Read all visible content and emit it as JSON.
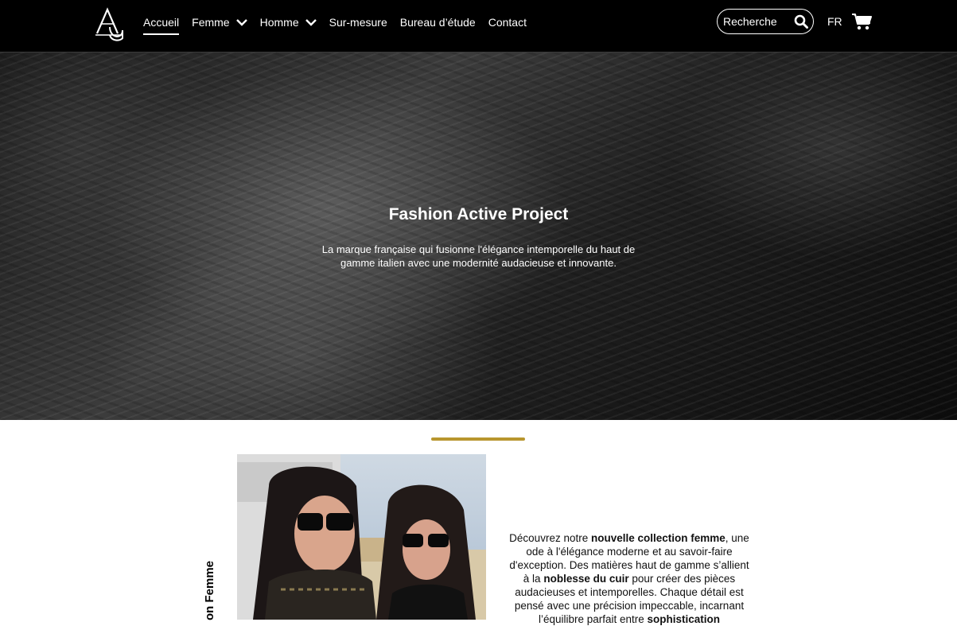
{
  "nav": {
    "logo_alt": "AG",
    "items": [
      {
        "label": "Accueil",
        "active": true,
        "dropdown": false
      },
      {
        "label": "Femme",
        "active": false,
        "dropdown": true
      },
      {
        "label": "Homme",
        "active": false,
        "dropdown": true
      },
      {
        "label": "Sur-mesure",
        "active": false,
        "dropdown": false
      },
      {
        "label": "Bureau d’étude",
        "active": false,
        "dropdown": false
      },
      {
        "label": "Contact",
        "active": false,
        "dropdown": false
      }
    ],
    "search_placeholder": "Recherche",
    "search_icon": "search-icon",
    "language": "FR",
    "cart_icon": "cart-icon"
  },
  "hero": {
    "title": "Fashion Active Project",
    "subtitle": "La marque française qui fusionne l'élégance intemporelle du haut de gamme italien avec une modernité audacieuse et innovante."
  },
  "collection": {
    "accent_color": "#b8962e",
    "side_title": "on Femme",
    "description": [
      {
        "text": "Découvrez notre ",
        "bold": false
      },
      {
        "text": "nouvelle collection femme",
        "bold": true
      },
      {
        "text": ", une ode à l'élégance moderne et au savoir-faire d'exception. Des matières haut de gamme s’allient à la ",
        "bold": false
      },
      {
        "text": "noblesse du cuir",
        "bold": true
      },
      {
        "text": " pour créer des pièces audacieuses et intemporelles. Chaque détail est pensé avec une précision impeccable, incarnant l’équilibre parfait entre ",
        "bold": false
      },
      {
        "text": "sophistication",
        "bold": true
      }
    ]
  }
}
